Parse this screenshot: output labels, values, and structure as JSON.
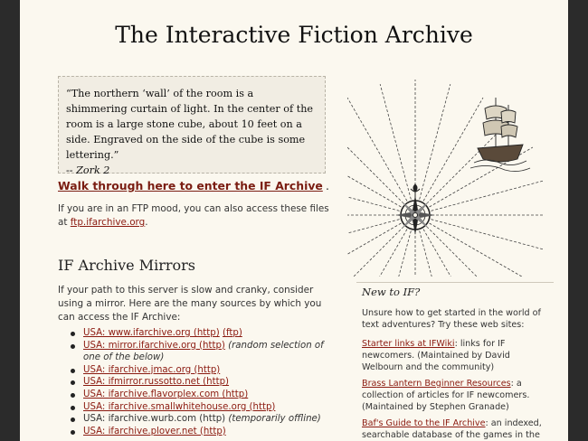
{
  "header": {
    "title": "The Interactive Fiction Archive"
  },
  "quote": {
    "text": "“The northern ‘wall’ of the room is a shimmering curtain of light. In the center of the room is a large stone cube, about 10 feet on a side. Engraved on the side of the cube is some lettering.”",
    "attribution": "-- Zork 2"
  },
  "enter": {
    "link_text": "Walk through here to enter the IF Archive",
    "suffix": "."
  },
  "ftp": {
    "text": "If you are in an FTP mood, you can also access these files at",
    "link_text": "ftp.ifarchive.org",
    "suffix": "."
  },
  "mirrors": {
    "heading": "IF Archive Mirrors",
    "intro": "If your path to this server is slow and cranky, consider using a mirror. Here are the many sources by which you can access the IF Archive:",
    "items": [
      {
        "link": "USA: www.ifarchive.org (http)",
        "link2": "(ftp)",
        "note": ""
      },
      {
        "link": "USA: mirror.ifarchive.org (http)",
        "link2": "",
        "note": "(random selection of one of the below)"
      },
      {
        "link": "USA: ifarchive.jmac.org (http)",
        "link2": "",
        "note": ""
      },
      {
        "link": "USA: ifmirror.russotto.net (http)",
        "link2": "",
        "note": ""
      },
      {
        "link": "USA: ifarchive.flavorplex.com (http)",
        "link2": "",
        "note": ""
      },
      {
        "link": "USA: ifarchive.smallwhitehouse.org (http)",
        "link2": "",
        "note": ""
      },
      {
        "plain": "USA: ifarchive.wurb.com (http)",
        "note": "(temporarily offline)"
      },
      {
        "link": "USA: ifarchive.plover.net (http)",
        "link2": "",
        "note": ""
      }
    ]
  },
  "sidebar": {
    "heading": "New to IF?",
    "intro": "Unsure how to get started in the world of text adventures? Try these web sites:",
    "entries": [
      {
        "link": "Starter links at IFWiki",
        "text": ": links for IF newcomers. (Maintained by David Welbourn and the community)"
      },
      {
        "link": "Brass Lantern Beginner Resources",
        "text": ": a collection of articles for IF newcomers. (Maintained by Stephen Granade)"
      },
      {
        "link": "Baf's Guide to the IF Archive",
        "text": ": an indexed, searchable database of the games in the"
      }
    ]
  },
  "colors": {
    "link": "#8b1a10",
    "page_bg": "#fbf8ef",
    "frame_bg": "#2b2b2b"
  },
  "illustration": {
    "icon": "compass-rose-ship-icon"
  }
}
